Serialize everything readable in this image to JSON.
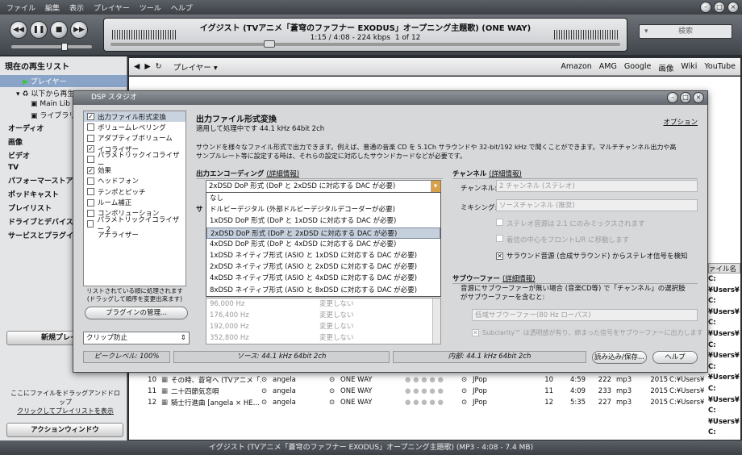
{
  "menu": [
    "ファイル",
    "編集",
    "表示",
    "プレイヤー",
    "ツール",
    "ヘルプ"
  ],
  "now": {
    "title": "イグジスト (TVアニメ「蒼穹のファフナー EXODUS」オープニング主題歌) (ONE WAY)",
    "info": "1:15 / 4:08 - 224 kbps",
    "pos": "1 of 12",
    "seek": 0.3
  },
  "search": "検索",
  "sidebar": {
    "head": "現在の再生リスト",
    "player": "プレイヤー",
    "from": "以下から再生",
    "lib": "Main Lib",
    "pl": "ライブラリを",
    "items": [
      "オーディオ",
      "画像",
      "ビデオ",
      "TV",
      "パフォーマーストア",
      "ポッドキャスト",
      "プレイリスト",
      "ドライブとデバイス",
      "サービスとプラグイン"
    ],
    "newpl": "新規プレイ",
    "drop": "ここにファイルをドラッグアンドドロップ",
    "click": "クリックしてプレイリストを表示",
    "action": "アクションウィンドウ"
  },
  "tab": "プレイヤー ▾",
  "links": [
    "Amazon",
    "AMG",
    "Google",
    "画像",
    "Wiki",
    "YouTube"
  ],
  "fname": "ァイル名",
  "users": [
    "C:¥Users¥",
    "C:¥Users¥",
    "C:¥Users¥",
    "C:¥Users¥",
    "C:¥Users¥",
    "C:¥Users¥",
    "C:¥Users¥",
    "C:¥Users¥"
  ],
  "rows": [
    {
      "n": "10",
      "t": "その時、蒼穹へ (TVアニメ「...",
      "a": "angela",
      "al": "ONE WAY",
      "g": "JPop",
      "tr": "10",
      "len": "4:59",
      "br": "222",
      "f": "mp3",
      "y": "2015",
      "p": "C:¥Users¥"
    },
    {
      "n": "11",
      "t": "二十四節気恋唄",
      "a": "angela",
      "al": "ONE WAY",
      "g": "JPop",
      "tr": "11",
      "len": "4:09",
      "br": "233",
      "f": "mp3",
      "y": "2015",
      "p": "C:¥Users¥"
    },
    {
      "n": "12",
      "t": "騎士行進曲 [angela × HE...",
      "a": "angela",
      "al": "ONE WAY",
      "g": "JPop",
      "tr": "12",
      "len": "5:35",
      "br": "227",
      "f": "mp3",
      "y": "2015",
      "p": "C:¥Users¥"
    }
  ],
  "status": "イグジスト (TVアニメ「蒼穹のファフナー EXODUS」オープニング主題歌) (MP3 - 4:08 - 7.4 MB)",
  "dsp": {
    "title": "DSP スタジオ",
    "list": [
      {
        "l": "出力ファイル形式変換",
        "c": true
      },
      {
        "l": "ボリュームレベリング",
        "c": false
      },
      {
        "l": "アダプティブボリューム",
        "c": false
      },
      {
        "l": "イコライザー",
        "c": true
      },
      {
        "l": "パラメトリックイコライザー",
        "c": false
      },
      {
        "l": "効果",
        "c": true
      },
      {
        "l": "ヘッドフォン",
        "c": false
      },
      {
        "l": "テンポとピッチ",
        "c": false
      },
      {
        "l": "ルーム補正",
        "c": false
      },
      {
        "l": "コンボリューション",
        "c": false
      },
      {
        "l": "パラメトリックイコライザー 2",
        "c": false
      },
      {
        "l": "アナライザー",
        "c": null
      }
    ],
    "note1": "リストされている順に処理されます",
    "note2": "(ドラッグして順序を変更出来ます)",
    "plugin": "プラグインの管理...",
    "clip": "クリップ防止",
    "peak": "ピークレベル: 100%",
    "src": "ソース: 44.1 kHz 64bit 2ch",
    "internal": "内部: 44.1 kHz 64bit 2ch",
    "load": "読み込み/保存...",
    "help": "ヘルプ",
    "h": "出力ファイル形式変換",
    "sub": "適用して処理中です 44.1 kHz 64bit 2ch",
    "option": "オプション",
    "desc1": "サウンドを様々なファイル形式で出力できます。例えば、普通の音楽 CD を 5.1Ch サラウンドや 32-bit/192 kHz で聞くことができます。マルチチャンネル出力や高",
    "desc2": "サンプルレート等に設定する時は、それらの設定に対応したサウンドカードなどが必要です。",
    "enc": "出力エンコーディング",
    "details": "(詳細情報)",
    "encval": "2xDSD DoP 形式 (DoP と 2xDSD に対応する DAC が必要)",
    "opts": [
      "なし",
      "ドルビーデジタル (外部ドルビーデジタルデコーダーが必要)",
      "1xDSD DoP 形式 (DoP と 1xDSD に対応する DAC が必要)",
      "2xDSD DoP 形式 (DoP と 2xDSD に対応する DAC が必要)",
      "4xDSD DoP 形式 (DoP と 4xDSD に対応する DAC が必要)",
      "1xDSD ネイティブ形式 (ASIO と 1xDSD に対応する DAC が必要)",
      "2xDSD ネイティブ形式 (ASIO と 2xDSD に対応する DAC が必要)",
      "4xDSD ネイティブ形式 (ASIO と 4xDSD に対応する DAC が必要)",
      "8xDSD ネイティブ形式 (ASIO と 8xDSD に対応する DAC が必要)"
    ],
    "sr": [
      {
        "r": "96,000 Hz",
        "v": "変更しない"
      },
      {
        "r": "176,400 Hz",
        "v": "変更しない"
      },
      {
        "r": "192,000 Hz",
        "v": "変更しない"
      },
      {
        "r": "352,800 Hz",
        "v": "変更しない"
      }
    ],
    "sa": "サ",
    "ch": "チャンネル",
    "chl": "チャンネル:",
    "chv": "2 チャンネル (ステレオ)",
    "mix": "ミキシング:",
    "mixv": "ソースチャンネル (推奨)",
    "c1": "ステレオ音源は 2.1 にのみミックスされます",
    "c2": "着信の中心をフロントL/R に移動します",
    "c3": "サラウンド音源 (合成サラウンド) からステレオ信号を検知",
    "sw": "サブウーファー",
    "sw1": "音源にサブウーファーが無い場合 (音楽CD等) で「チャンネル」の選択肢",
    "sw2": "がサブウーファーを含むと:",
    "swv": "低域サブウーファー(80 Hz ローパス)",
    "sw3": "Subclarity™ は透明感が有り、締まった信号をサブウーファーに出力します"
  }
}
